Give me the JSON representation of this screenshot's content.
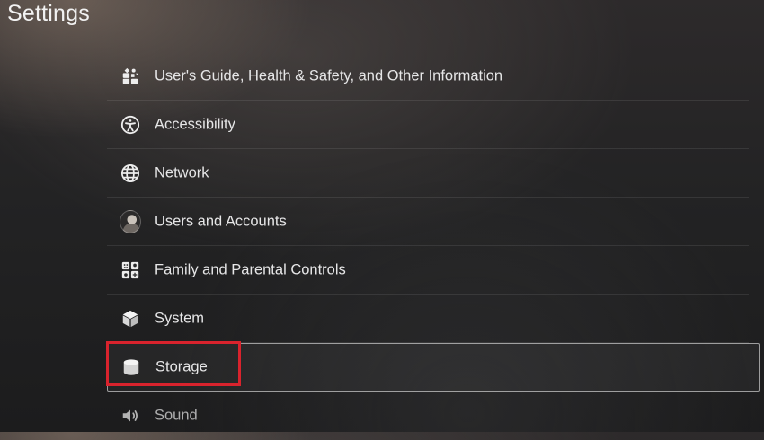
{
  "page": {
    "title": "Settings"
  },
  "menu": {
    "items": [
      {
        "label": "User's Guide, Health & Safety, and Other Information",
        "icon": "guide-icon"
      },
      {
        "label": "Accessibility",
        "icon": "accessibility-icon"
      },
      {
        "label": "Network",
        "icon": "globe-icon"
      },
      {
        "label": "Users and Accounts",
        "icon": "user-avatar"
      },
      {
        "label": "Family and Parental Controls",
        "icon": "family-icon"
      },
      {
        "label": "System",
        "icon": "cube-icon"
      },
      {
        "label": "Storage",
        "icon": "storage-icon",
        "selected": true
      },
      {
        "label": "Sound",
        "icon": "speaker-icon"
      }
    ]
  },
  "annotation": {
    "highlight_color": "#d9232d",
    "highlighted_item": "Storage"
  }
}
